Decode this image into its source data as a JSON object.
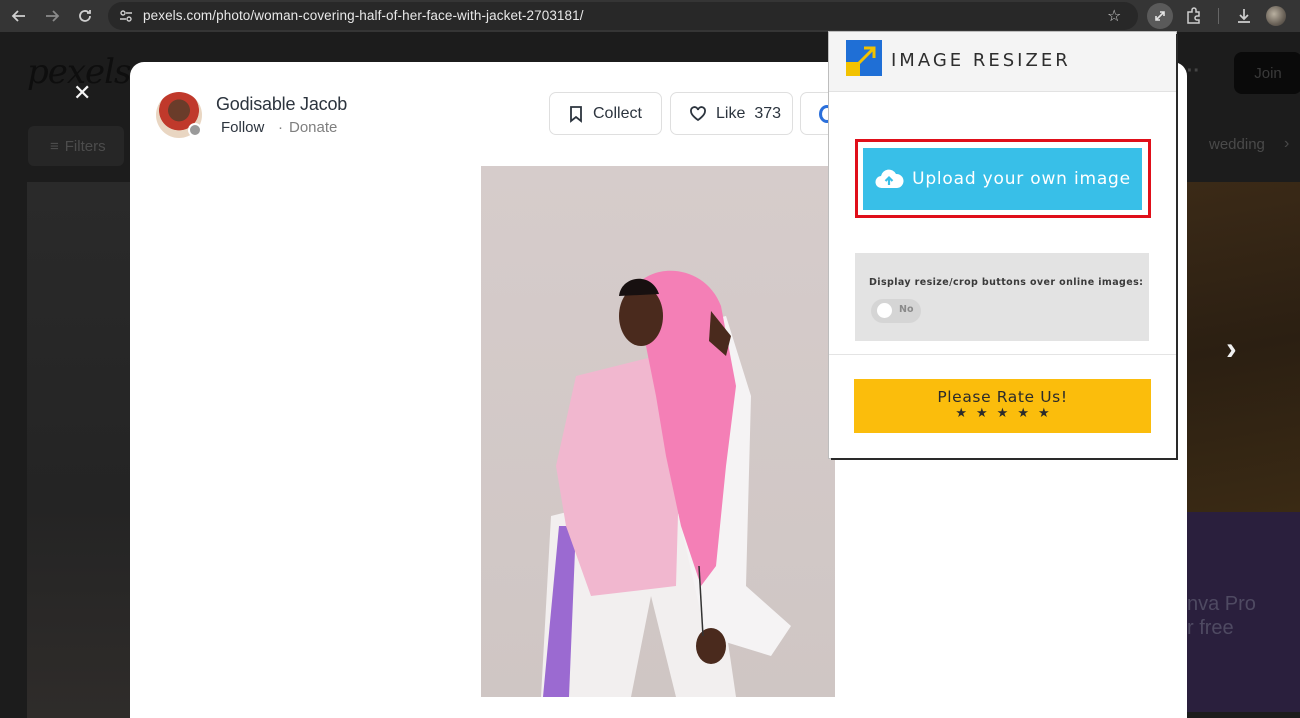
{
  "browser": {
    "url": "pexels.com/photo/woman-covering-half-of-her-face-with-jacket-2703181/",
    "icons": [
      "back-icon",
      "forward-icon",
      "reload-icon",
      "site-settings-icon",
      "bookmark-star-icon",
      "image-resizer-extension-icon",
      "extensions-icon",
      "downloads-icon",
      "profile-avatar"
    ]
  },
  "page": {
    "logo": "pexels",
    "join_label": "Join",
    "filters_label": "Filters",
    "tag_wedding": "wedding",
    "promo_line1": "nva Pro",
    "promo_line2": "r free"
  },
  "modal": {
    "author": {
      "name": "Godisable Jacob",
      "follow_label": "Follow",
      "donate_label": "Donate",
      "separator": "·"
    },
    "actions": {
      "collect_label": "Collect",
      "like_label": "Like",
      "like_count": "373"
    },
    "photo_alt": "woman covering half of her face with jacket"
  },
  "extension": {
    "title": "IMAGE RESIZER",
    "upload_label": "Upload your own image",
    "option_label": "Display resize/crop buttons over online images:",
    "toggle_state": "No",
    "rate_label": "Please Rate Us!",
    "rate_stars": "★★★★★",
    "highlight_color": "#e00f1a",
    "upload_color": "#38bfe8",
    "rate_color": "#fbbd0c"
  }
}
